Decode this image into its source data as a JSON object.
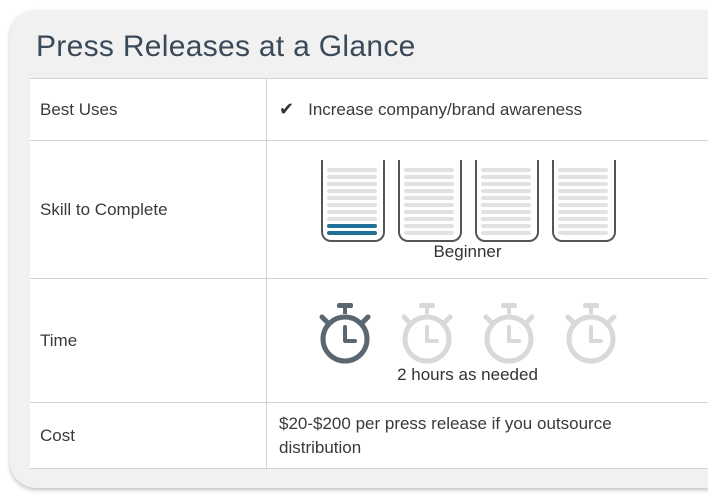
{
  "title": "Press Releases at a Glance",
  "rows": [
    {
      "label": "Best Uses",
      "value": "Increase company/brand awareness",
      "icon": "checkmark-icon"
    },
    {
      "label": "Skill to Complete",
      "caption": "Beginner",
      "level": 1,
      "max_level": 4
    },
    {
      "label": "Time",
      "caption": "2 hours as needed",
      "level": 1,
      "max_level": 4
    },
    {
      "label": "Cost",
      "value": "$20-$200 per press release if you outsource distribution"
    }
  ],
  "colors": {
    "accent": "#1f6f96",
    "active_icon": "#5a6770",
    "inactive_icon": "#d9d9d9"
  }
}
